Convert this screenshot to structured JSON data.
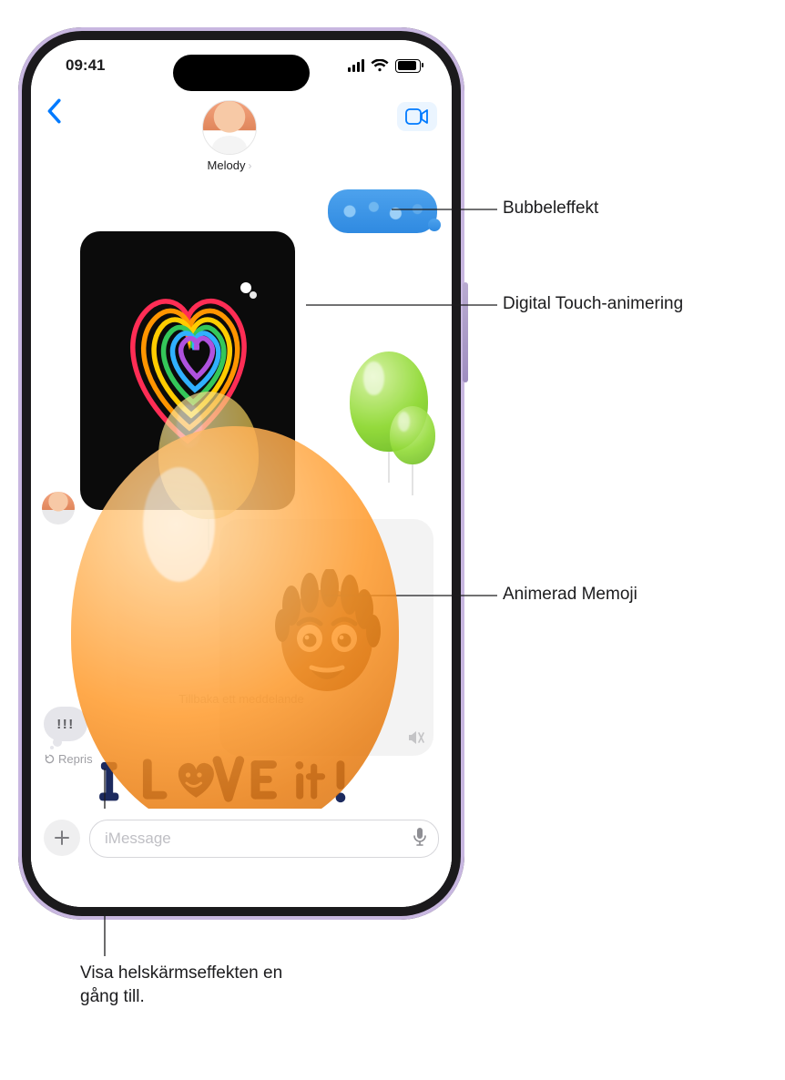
{
  "status": {
    "time": "09:41"
  },
  "contact": {
    "name": "Melody"
  },
  "messages": {
    "memoji_hint": "Tillbaka ett meddelande",
    "tapback": "!!!",
    "repris": "Repris"
  },
  "handwriting_text": "I LOVE it!",
  "compose": {
    "placeholder": "iMessage"
  },
  "callouts": {
    "bubble": "Bubbeleffekt",
    "digital_touch": "Digital Touch-animering",
    "memoji": "Animerad Memoji",
    "replay": "Visa helskärmseffekten en gång till."
  }
}
